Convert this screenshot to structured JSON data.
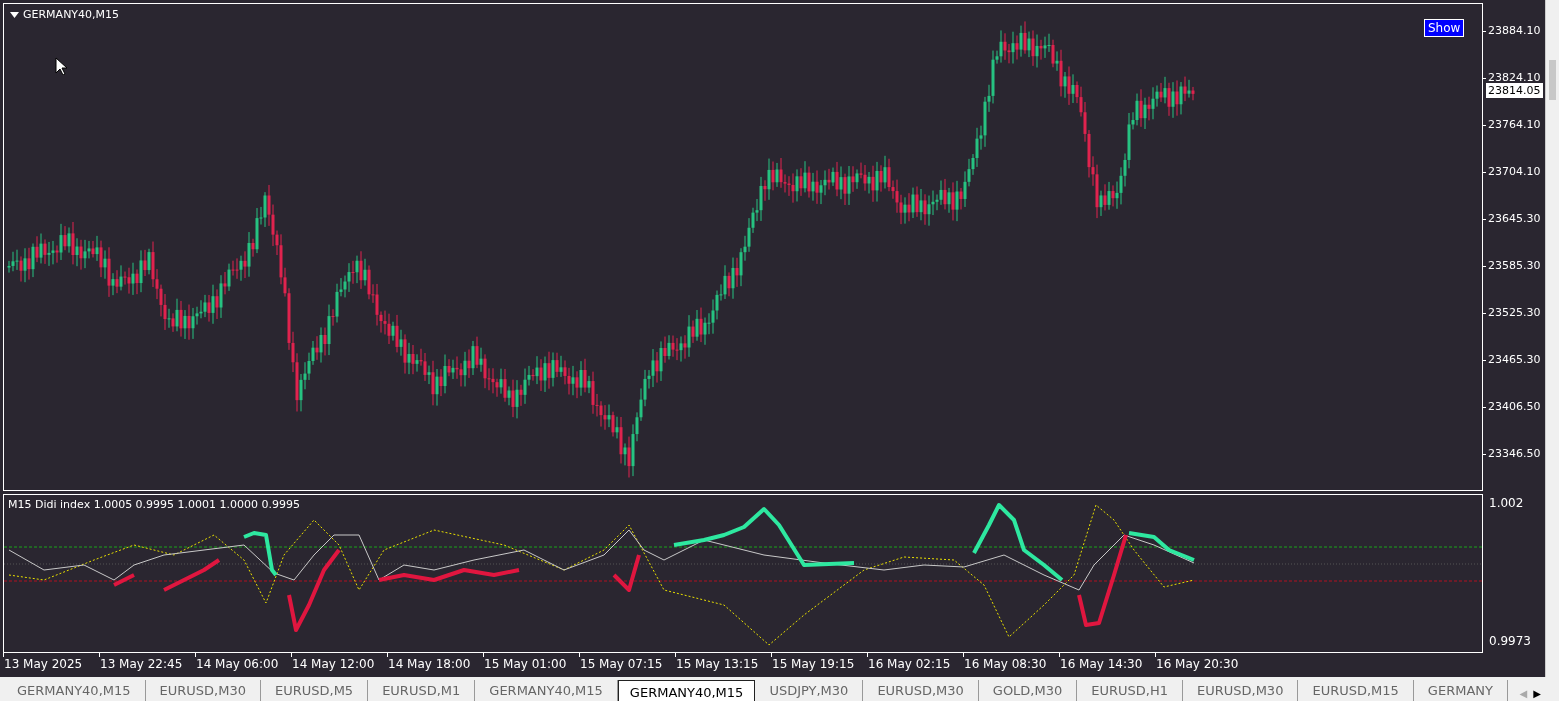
{
  "chart": {
    "title": "GERMANY40,M15",
    "show_button": "Show",
    "current_price": "23814.05",
    "price_axis": [
      "23884.10",
      "23824.10",
      "23764.10",
      "23704.10",
      "23645.30",
      "23585.30",
      "23525.30",
      "23465.30",
      "23406.50",
      "23346.50"
    ],
    "indicator": {
      "label": "M15 Didi index 1.0005 0.9995 1.0001 1.0000 0.9995",
      "axis": [
        "1.002",
        "0.9973"
      ]
    },
    "time_axis": [
      "13 May 2025",
      "13 May 22:45",
      "14 May 06:00",
      "14 May 12:00",
      "14 May 18:00",
      "15 May 01:00",
      "15 May 07:15",
      "15 May 13:15",
      "15 May 19:15",
      "16 May 02:15",
      "16 May 08:30",
      "16 May 14:30",
      "16 May 20:30"
    ]
  },
  "tabs": [
    {
      "label": "GERMANY40,M15",
      "selected": false
    },
    {
      "label": "EURUSD,M30",
      "selected": false
    },
    {
      "label": "EURUSD,M5",
      "selected": false
    },
    {
      "label": "EURUSD,M1",
      "selected": false
    },
    {
      "label": "GERMANY40,M15",
      "selected": false
    },
    {
      "label": "GERMANY40,M15",
      "selected": true
    },
    {
      "label": "USDJPY,M30",
      "selected": false
    },
    {
      "label": "EURUSD,M30",
      "selected": false
    },
    {
      "label": "GOLD,M30",
      "selected": false
    },
    {
      "label": "EURUSD,H1",
      "selected": false
    },
    {
      "label": "EURUSD,M30",
      "selected": false
    },
    {
      "label": "EURUSD,M15",
      "selected": false
    },
    {
      "label": "GERMANY",
      "selected": false
    }
  ],
  "tab_scroll": [
    {
      "glyph": "◀",
      "disabled": true
    },
    {
      "glyph": "▶",
      "disabled": false
    }
  ]
}
